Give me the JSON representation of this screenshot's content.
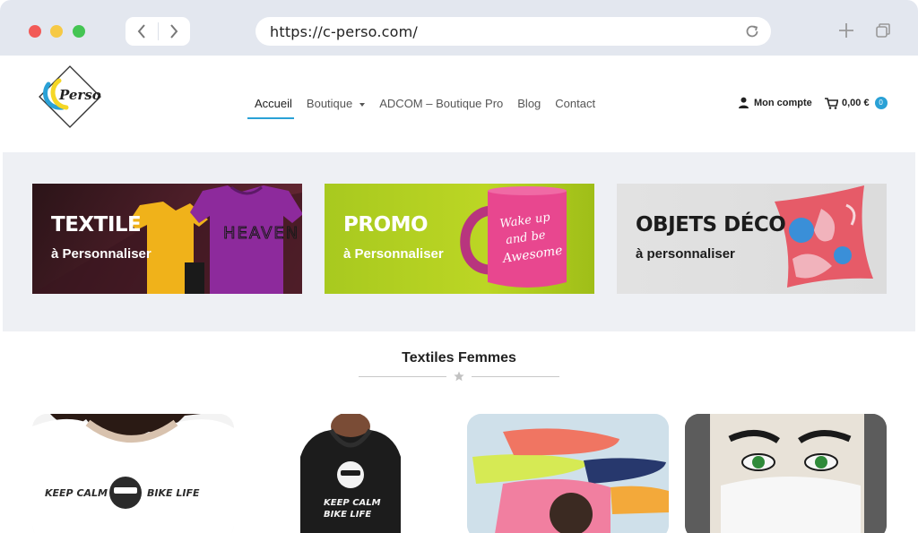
{
  "browser": {
    "url": "https://c-perso.com/",
    "icons": [
      "back-icon",
      "forward-icon",
      "reload-icon",
      "new-tab-icon",
      "tabs-icon"
    ]
  },
  "site": {
    "logo_text": "Perso",
    "nav": [
      {
        "label": "Accueil",
        "active": true
      },
      {
        "label": "Boutique",
        "dropdown": true
      },
      {
        "label": "ADCOM – Boutique Pro"
      },
      {
        "label": "Blog"
      },
      {
        "label": "Contact"
      }
    ],
    "account_label": "Mon compte",
    "cart_total": "0,00 €",
    "cart_count": "0",
    "accent_color": "#2aa1d6"
  },
  "banners": [
    {
      "title": "TEXTILE",
      "subtitle": "à Personnaliser",
      "shirt_text": "HEAVEN"
    },
    {
      "title": "PROMO",
      "subtitle": "à Personnaliser",
      "mug_text": "Wake up and be Awesome"
    },
    {
      "title": "OBJETS DÉCO",
      "subtitle": "à personnaliser"
    }
  ],
  "section": {
    "title": "Textiles Femmes"
  },
  "products": [
    {
      "name": "tshirt-keep-calm",
      "print_text": "KEEP CALM  BIKE LIFE"
    },
    {
      "name": "hoodie-keep-calm",
      "print_text": "KEEP CALM BIKE LIFE"
    },
    {
      "name": "pillows"
    },
    {
      "name": "face-mask"
    }
  ]
}
